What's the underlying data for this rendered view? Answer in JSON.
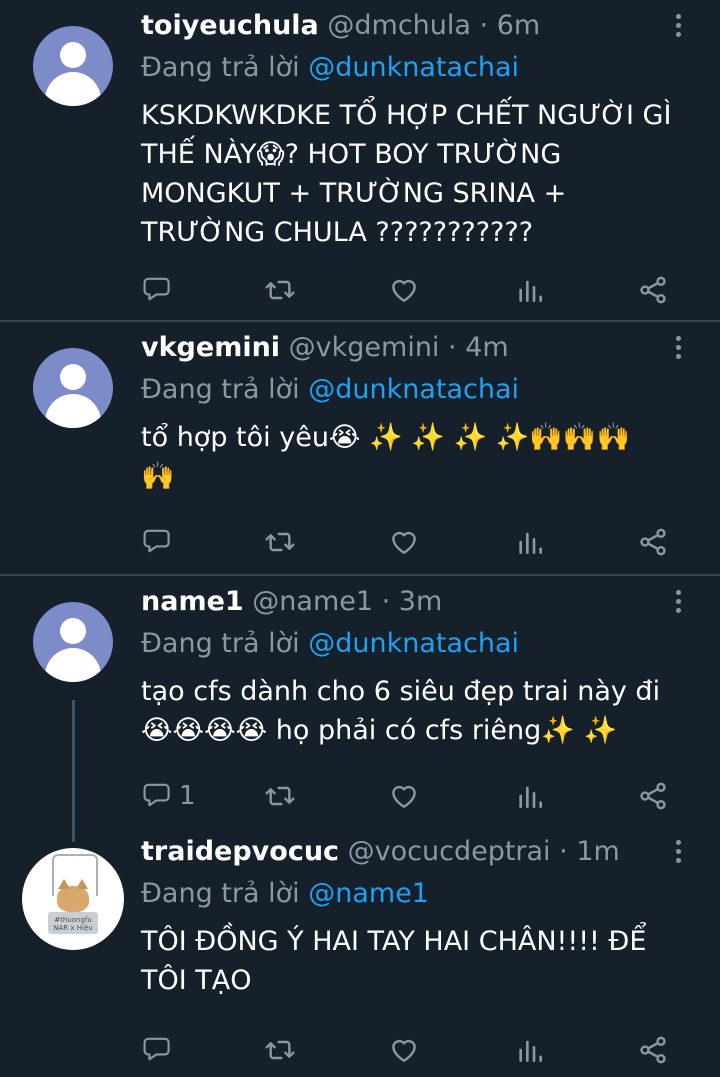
{
  "tweets": [
    {
      "display_name": "toiyeuchula",
      "handle": "@dmchula",
      "time": "6m",
      "reply_prefix": "Đang trả lời",
      "reply_to": "@dunknatachai",
      "text": "KSKDKWKDKE TỔ HỢP CHẾT NGƯỜI GÌ THẾ NÀY😱? HOT BOY TRƯỜNG MONGKUT + TRƯỜNG SRINA + TRƯỜNG CHULA ???????????",
      "reply_count": ""
    },
    {
      "display_name": "vkgemini",
      "handle": "@vkgemini",
      "time": "4m",
      "reply_prefix": "Đang trả lời",
      "reply_to": "@dunknatachai",
      "text": "tổ hợp tôi yêu😭 ✨ ✨ ✨ ✨🙌🙌🙌\n🙌",
      "reply_count": ""
    },
    {
      "display_name": "name1",
      "handle": "@name1",
      "time": "3m",
      "reply_prefix": "Đang trả lời",
      "reply_to": "@dunknatachai",
      "text": "tạo cfs dành cho 6 siêu đẹp trai này đi\n😭😭😭😭 họ phải có cfs riêng✨ ✨",
      "reply_count": "1"
    },
    {
      "display_name": "traidepvocuc",
      "handle": "@vocucdeptrai",
      "time": "1m",
      "reply_prefix": "Đang trả lời",
      "reply_to": "@name1",
      "text": "TÔI ĐỒNG Ý HAI TAY HAI CHÂN!!!! ĐỂ TÔI TẠO",
      "reply_count": "",
      "avatar_caption": "#thuongfu\nNAR x Hiệu"
    }
  ],
  "separator": " · ",
  "icons": [
    "reply-icon",
    "retweet-icon",
    "like-icon",
    "stats-icon",
    "share-icon",
    "more-icon"
  ],
  "colors": {
    "background": "#15202b",
    "muted": "#8899a6",
    "mention": "#1da1f2",
    "divider": "#38444d"
  }
}
